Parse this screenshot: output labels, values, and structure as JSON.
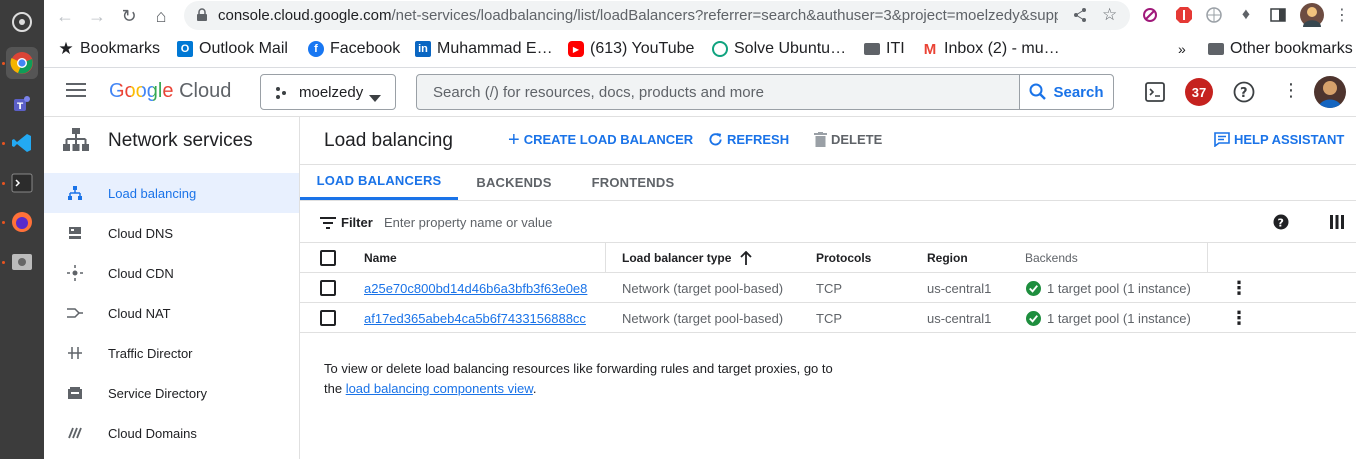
{
  "browser": {
    "url_host": "console.cloud.google.com",
    "url_path": "/net-services/loadbalancing/list/loadBalancers?referrer=search&authuser=3&project=moelzedy&support…",
    "bookmarks": [
      {
        "label": "Bookmarks",
        "icon": "star-icon"
      },
      {
        "label": "Outlook Mail",
        "icon": "outlook-icon"
      },
      {
        "label": "Facebook",
        "icon": "facebook-icon"
      },
      {
        "label": "Muhammad E…",
        "icon": "linkedin-icon"
      },
      {
        "label": "(613) YouTube",
        "icon": "youtube-icon"
      },
      {
        "label": "Solve Ubuntu…",
        "icon": "openai-icon"
      },
      {
        "label": "ITI",
        "icon": "folder-icon"
      },
      {
        "label": "Inbox (2) - mu…",
        "icon": "gmail-icon"
      }
    ],
    "more_bookmarks": "»",
    "other_bookmarks": "Other bookmarks"
  },
  "header": {
    "logo_google": "Google",
    "logo_cloud": "Cloud",
    "project": "moelzedy",
    "search_placeholder": "Search (/) for resources, docs, products and more",
    "search_button": "Search",
    "notifications_count": "37"
  },
  "sidebar": {
    "title": "Network services",
    "items": [
      {
        "label": "Load balancing",
        "icon": "load-balancing-icon",
        "active": true
      },
      {
        "label": "Cloud DNS",
        "icon": "dns-icon"
      },
      {
        "label": "Cloud CDN",
        "icon": "cdn-icon"
      },
      {
        "label": "Cloud NAT",
        "icon": "nat-icon"
      },
      {
        "label": "Traffic Director",
        "icon": "traffic-director-icon"
      },
      {
        "label": "Service Directory",
        "icon": "service-directory-icon"
      },
      {
        "label": "Cloud Domains",
        "icon": "domains-icon"
      }
    ]
  },
  "main": {
    "title": "Load balancing",
    "create_label": "CREATE LOAD BALANCER",
    "refresh_label": "REFRESH",
    "delete_label": "DELETE",
    "help_label": "HELP ASSISTANT",
    "tabs": [
      "LOAD BALANCERS",
      "BACKENDS",
      "FRONTENDS"
    ],
    "filter_label": "Filter",
    "filter_placeholder": "Enter property name or value",
    "table": {
      "columns": [
        "Name",
        "Load balancer type",
        "Protocols",
        "Region",
        "Backends"
      ],
      "rows": [
        {
          "name": "a25e70c800bd14d46b6a3bfb3f63e0e8",
          "type": "Network (target pool-based)",
          "protocol": "TCP",
          "region": "us-central1",
          "backends": "1 target pool (1 instance)"
        },
        {
          "name": "af17ed365abeb4ca5b6f7433156888cc",
          "type": "Network (target pool-based)",
          "protocol": "TCP",
          "region": "us-central1",
          "backends": "1 target pool (1 instance)"
        }
      ]
    },
    "info_text_1": "To view or delete load balancing resources like forwarding rules and target proxies, go to",
    "info_text_2a": "the ",
    "info_link": "load balancing components view",
    "info_text_2b": "."
  },
  "colors": {
    "accent": "#1a73e8",
    "active_bg": "#e8f0fe",
    "success": "#1e8e3e",
    "badge": "#c5221f"
  }
}
